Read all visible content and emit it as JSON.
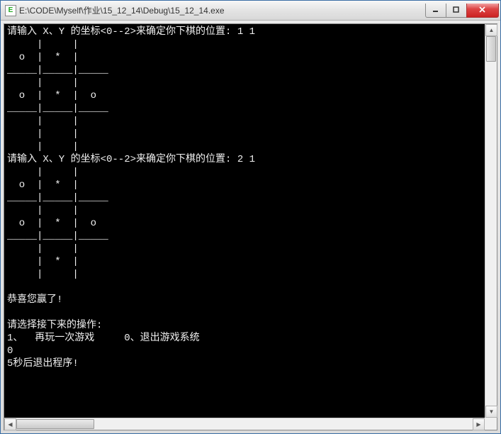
{
  "titlebar": {
    "title": "E:\\CODE\\Myself\\作业\\15_12_14\\Debug\\15_12_14.exe",
    "icon_char": "E"
  },
  "console": {
    "lines": [
      "请输入 X、Y 的坐标<0--2>来确定你下棋的位置: 1 1",
      "     |     |",
      "  o  |  *  |",
      "_____|_____|_____",
      "     |     |",
      "  o  |  *  |  o",
      "_____|_____|_____",
      "     |     |",
      "     |     |",
      "     |     |",
      "请输入 X、Y 的坐标<0--2>来确定你下棋的位置: 2 1",
      "     |     |",
      "  o  |  *  |",
      "_____|_____|_____",
      "     |     |",
      "  o  |  *  |  o",
      "_____|_____|_____",
      "     |     |",
      "     |  *  |",
      "     |     |",
      "",
      "恭喜您赢了!",
      "",
      "请选择接下来的操作:",
      "1、  再玩一次游戏     0、退出游戏系统",
      "0",
      "5秒后退出程序!"
    ]
  }
}
